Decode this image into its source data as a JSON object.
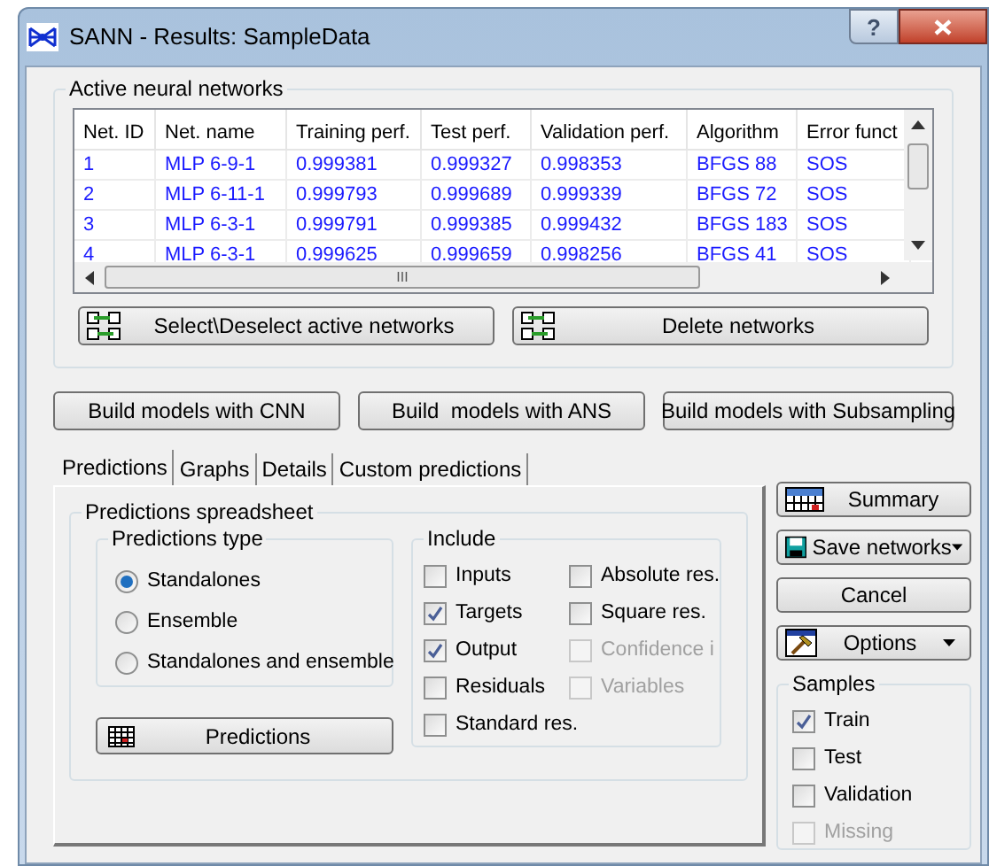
{
  "window": {
    "title": "SANN - Results: SampleData",
    "help_button": "?"
  },
  "networks": {
    "title": "Active neural networks",
    "columns": [
      "Net. ID",
      "Net. name",
      "Training perf.",
      "Test perf.",
      "Validation perf.",
      "Algorithm",
      "Error funct"
    ],
    "rows": [
      [
        "1",
        "MLP 6-9-1",
        "0.999381",
        "0.999327",
        "0.998353",
        "BFGS 88",
        "SOS"
      ],
      [
        "2",
        "MLP 6-11-1",
        "0.999793",
        "0.999689",
        "0.999339",
        "BFGS 72",
        "SOS"
      ],
      [
        "3",
        "MLP 6-3-1",
        "0.999791",
        "0.999385",
        "0.999432",
        "BFGS 183",
        "SOS"
      ],
      [
        "4",
        "MLP 6-3-1",
        "0.999625",
        "0.999659",
        "0.998256",
        "BFGS 41",
        "SOS"
      ]
    ],
    "scroll_grip": "III",
    "buttons": [
      "Select\\Deselect active networks",
      "Delete networks"
    ]
  },
  "build_buttons": [
    "Build models with CNN",
    "Build  models with ANS",
    "Build models with Subsampling"
  ],
  "tabs": [
    {
      "label": "Predictions",
      "selected": true
    },
    {
      "label": "Graphs",
      "selected": false
    },
    {
      "label": "Details",
      "selected": false
    },
    {
      "label": "Custom predictions",
      "selected": false
    }
  ],
  "spreadsheet": {
    "title": "Predictions spreadsheet",
    "type_group": {
      "title": "Predictions type",
      "options": [
        {
          "label": "Standalones",
          "selected": true
        },
        {
          "label": "Ensemble",
          "selected": false
        },
        {
          "label": "Standalones and ensemble",
          "selected": false
        }
      ]
    },
    "include": {
      "title": "Include",
      "left": [
        {
          "label": "Inputs",
          "checked": false,
          "disabled": false
        },
        {
          "label": "Targets",
          "checked": true,
          "disabled": false
        },
        {
          "label": "Output",
          "checked": true,
          "disabled": false
        },
        {
          "label": "Residuals",
          "checked": false,
          "disabled": false
        },
        {
          "label": "Standard res.",
          "checked": false,
          "disabled": false
        }
      ],
      "right": [
        {
          "label": "Absolute res.",
          "checked": false,
          "disabled": false
        },
        {
          "label": "Square res.",
          "checked": false,
          "disabled": false
        },
        {
          "label": "Confidence i",
          "checked": false,
          "disabled": true
        },
        {
          "label": "Variables",
          "checked": false,
          "disabled": true
        }
      ]
    },
    "button": "Predictions"
  },
  "side_buttons": [
    {
      "kind": "summary",
      "label": "Summary"
    },
    {
      "kind": "save",
      "label": "Save networks"
    },
    {
      "kind": "plain",
      "label": "Cancel"
    },
    {
      "kind": "options",
      "label": "Options"
    }
  ],
  "samples": {
    "title": "Samples",
    "items": [
      {
        "label": "Train",
        "checked": true,
        "disabled": false
      },
      {
        "label": "Test",
        "checked": false,
        "disabled": false
      },
      {
        "label": "Validation",
        "checked": false,
        "disabled": false
      },
      {
        "label": "Missing",
        "checked": false,
        "disabled": true
      }
    ]
  }
}
